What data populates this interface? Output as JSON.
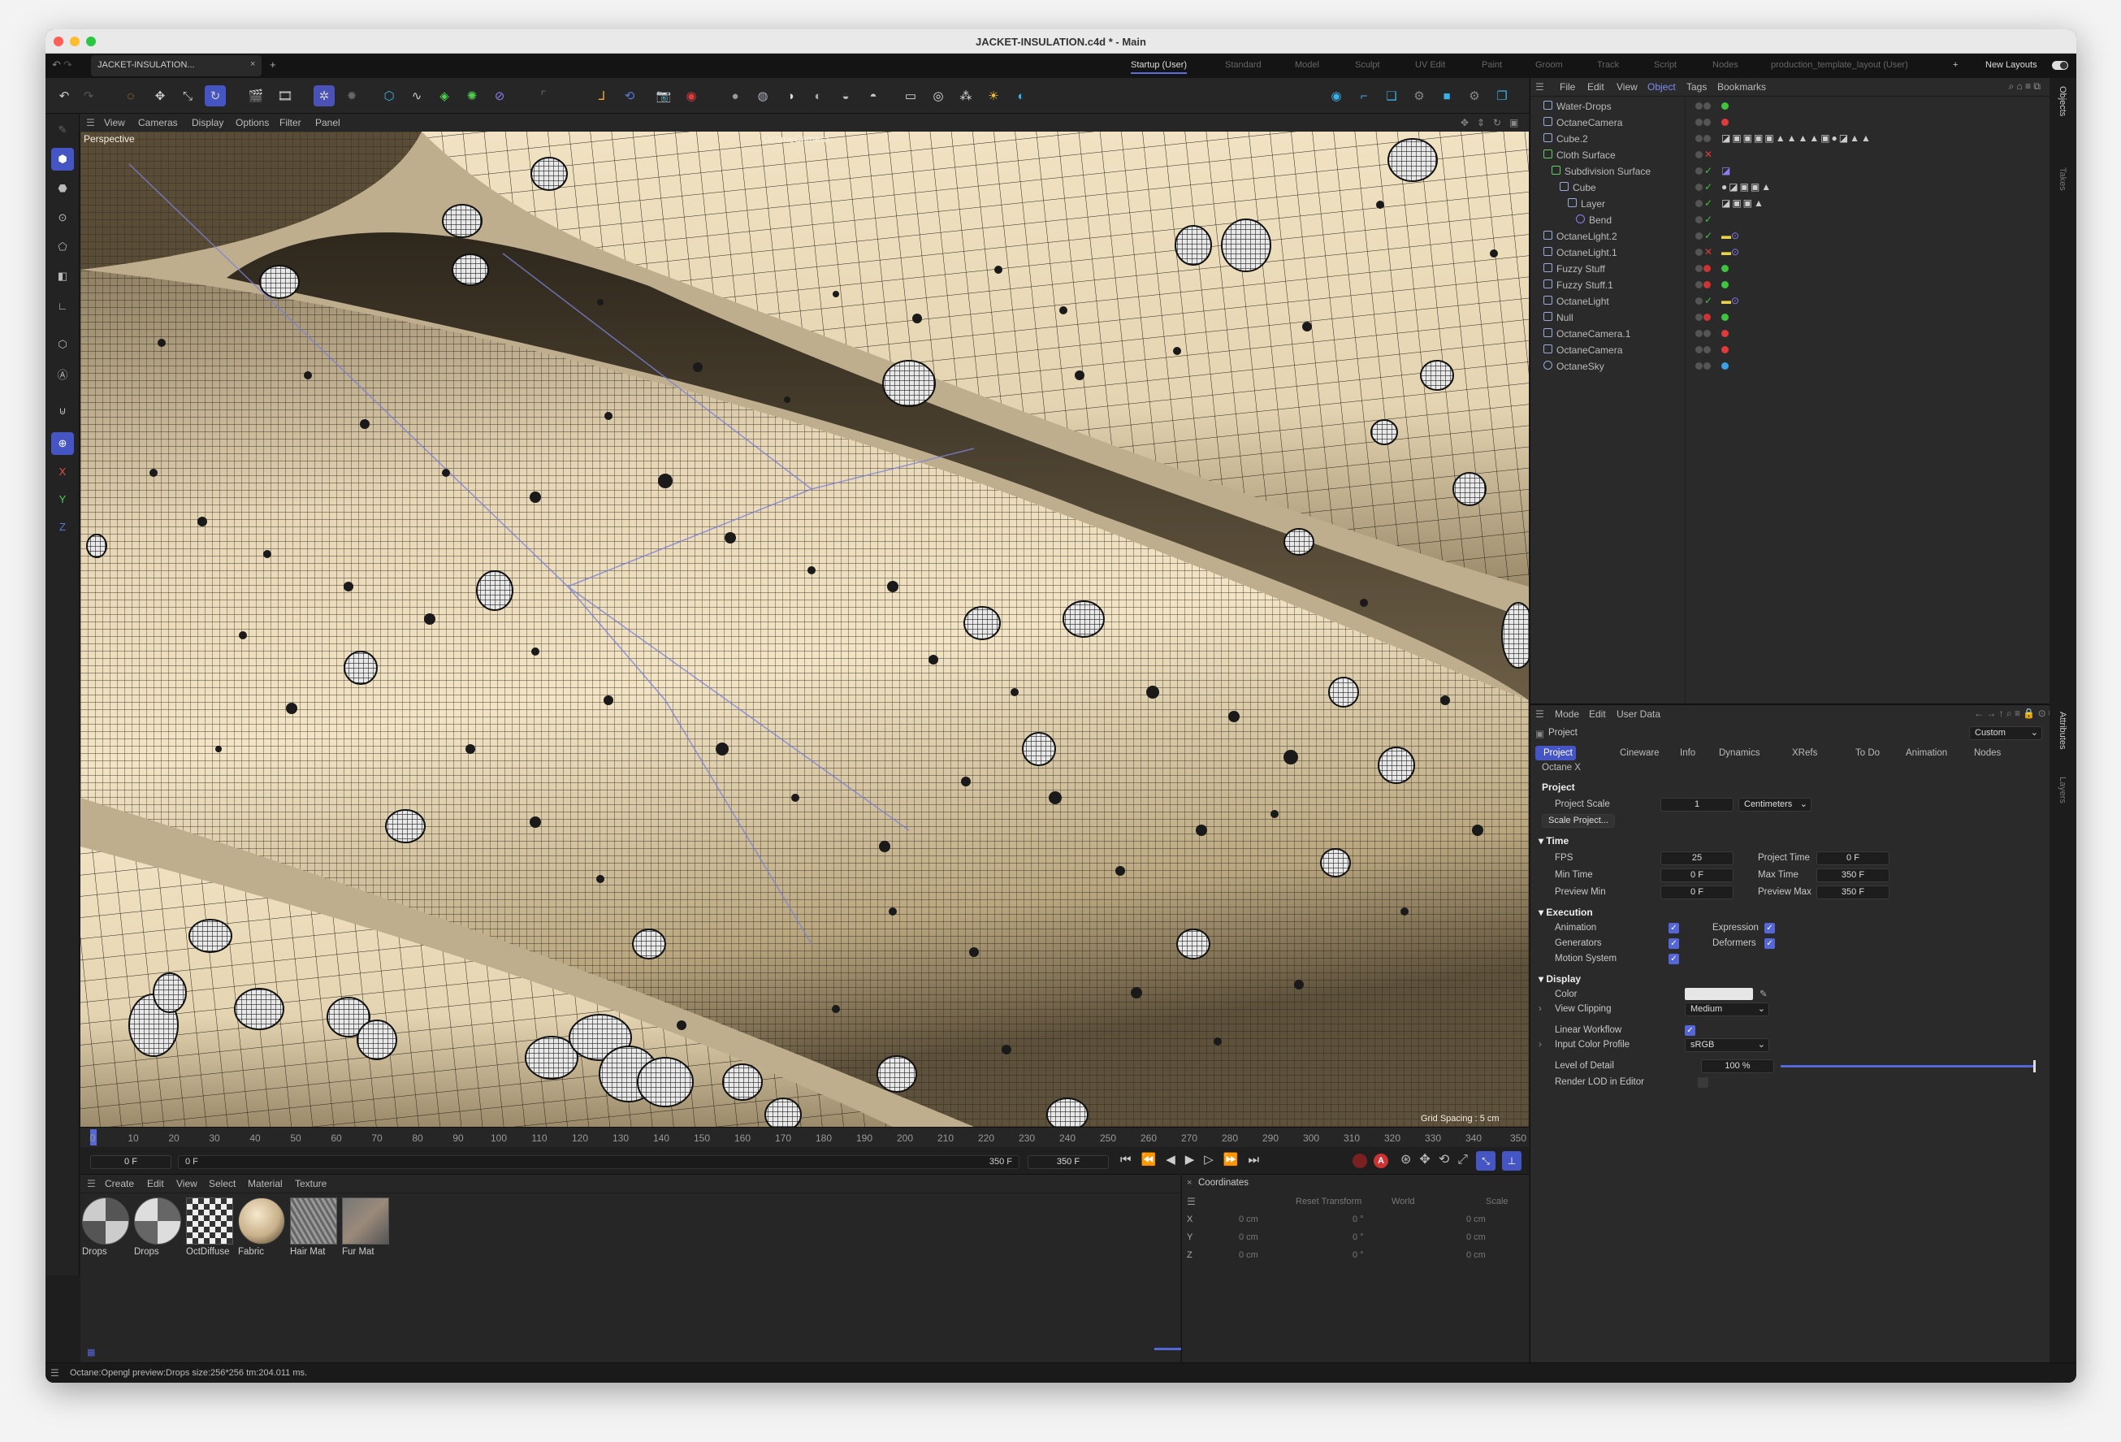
{
  "window": {
    "title": "JACKET-INSULATION.c4d * - Main"
  },
  "tabs": {
    "doc_tab": "JACKET-INSULATION...",
    "close": "×",
    "add": "+"
  },
  "layouts": {
    "items": [
      "Startup (User)",
      "Standard",
      "Model",
      "Sculpt",
      "UV Edit",
      "Paint",
      "Groom",
      "Track",
      "Script",
      "Nodes",
      "production_template_layout (User)"
    ],
    "active": "Startup (User)",
    "add": "+",
    "new_layouts": "New Layouts"
  },
  "viewport": {
    "menu": [
      "View",
      "Cameras",
      "Display",
      "Options",
      "Filter",
      "Panel"
    ],
    "label": "Perspective",
    "camera": "OctaneCamera",
    "grid_spacing": "Grid Spacing : 5 cm"
  },
  "left_tools": {
    "axes": [
      "X",
      "Y",
      "Z"
    ]
  },
  "timeline": {
    "ticks": [
      "0",
      "10",
      "20",
      "30",
      "40",
      "50",
      "60",
      "70",
      "80",
      "90",
      "100",
      "110",
      "120",
      "130",
      "140",
      "150",
      "160",
      "170",
      "180",
      "190",
      "200",
      "210",
      "220",
      "230",
      "240",
      "250",
      "260",
      "270",
      "280",
      "290",
      "300",
      "310",
      "320",
      "330",
      "340",
      "350"
    ],
    "current": "0 F",
    "start": "0 F",
    "end": "350 F",
    "end2": "350 F"
  },
  "material_manager": {
    "menu": [
      "Create",
      "Edit",
      "View",
      "Select",
      "Material",
      "Texture"
    ],
    "materials": [
      "Drops",
      "Drops",
      "OctDiffuse",
      "Fabric",
      "Hair Mat",
      "Fur Mat"
    ]
  },
  "coordinates": {
    "title": "Coordinates",
    "reset": "Reset Transform",
    "space": "World",
    "mode": "Scale",
    "rows": [
      {
        "axis": "X",
        "pos": "0 cm",
        "rot": "0 °",
        "scale": "0 cm"
      },
      {
        "axis": "Y",
        "pos": "0 cm",
        "rot": "0 °",
        "scale": "0 cm"
      },
      {
        "axis": "Z",
        "pos": "0 cm",
        "rot": "0 °",
        "scale": "0 cm"
      }
    ]
  },
  "status": {
    "text": "Octane:Opengl preview:Drops  size:256*256  tm:204.011 ms."
  },
  "object_manager": {
    "menu": [
      "File",
      "Edit",
      "View",
      "Object",
      "Tags",
      "Bookmarks"
    ],
    "active_menu": "Object",
    "objects": [
      {
        "name": "Water-Drops",
        "indent": 0,
        "color": "#3ec43e"
      },
      {
        "name": "OctaneCamera",
        "indent": 0,
        "color": "#e03b3b"
      },
      {
        "name": "Cube.2",
        "indent": 0,
        "color": "#5a7ad6"
      },
      {
        "name": "Cloth Surface",
        "indent": 0,
        "color": "#e03b3b"
      },
      {
        "name": "Subdivision Surface",
        "indent": 1,
        "color": "#5a7ad6"
      },
      {
        "name": "Cube",
        "indent": 2,
        "color": "#3ec43e"
      },
      {
        "name": "Layer",
        "indent": 3,
        "color": "#5a7ad6"
      },
      {
        "name": "Bend",
        "indent": 4,
        "color": ""
      },
      {
        "name": "OctaneLight.2",
        "indent": 0,
        "color": "#e8d24a"
      },
      {
        "name": "OctaneLight.1",
        "indent": 0,
        "color": "#e8d24a"
      },
      {
        "name": "Fuzzy Stuff",
        "indent": 0,
        "color": "#3ec43e"
      },
      {
        "name": "Fuzzy Stuff.1",
        "indent": 0,
        "color": "#3ec43e"
      },
      {
        "name": "OctaneLight",
        "indent": 0,
        "color": "#e8d24a"
      },
      {
        "name": "Null",
        "indent": 0,
        "color": "#3ec43e"
      },
      {
        "name": "OctaneCamera.1",
        "indent": 0,
        "color": "#e03b3b"
      },
      {
        "name": "OctaneCamera",
        "indent": 0,
        "color": "#e03b3b"
      },
      {
        "name": "OctaneSky",
        "indent": 0,
        "color": "#3aa0e8"
      }
    ]
  },
  "attributes": {
    "menu": [
      "Mode",
      "Edit",
      "User Data"
    ],
    "title": "Project",
    "preset": "Custom",
    "tabs": [
      "Project",
      "Cineware",
      "Info",
      "Dynamics",
      "XRefs",
      "To Do",
      "Animation",
      "Nodes"
    ],
    "tab2": "Octane X",
    "section_project": "Project",
    "project_scale_label": "Project Scale",
    "project_scale": "1",
    "project_scale_unit": "Centimeters",
    "scale_project_btn": "Scale Project...",
    "time": {
      "heading": "Time",
      "fps_label": "FPS",
      "fps": "25",
      "project_time_label": "Project Time",
      "project_time": "0 F",
      "min_time_label": "Min Time",
      "min_time": "0 F",
      "max_time_label": "Max Time",
      "max_time": "350 F",
      "preview_min_label": "Preview Min",
      "preview_min": "0 F",
      "preview_max_label": "Preview Max",
      "preview_max": "350 F"
    },
    "execution": {
      "heading": "Execution",
      "animation": "Animation",
      "expression": "Expression",
      "generators": "Generators",
      "deformers": "Deformers",
      "motion_system": "Motion System"
    },
    "display": {
      "heading": "Display",
      "color_label": "Color",
      "view_clipping_label": "View Clipping",
      "view_clipping": "Medium",
      "linear_workflow": "Linear Workflow",
      "input_color_profile_label": "Input Color Profile",
      "input_color_profile": "sRGB",
      "lod_label": "Level of Detail",
      "lod": "100 %",
      "render_lod": "Render LOD in Editor"
    }
  },
  "side_tabs": [
    "Objects",
    "Takes",
    "Attributes",
    "Layers"
  ]
}
